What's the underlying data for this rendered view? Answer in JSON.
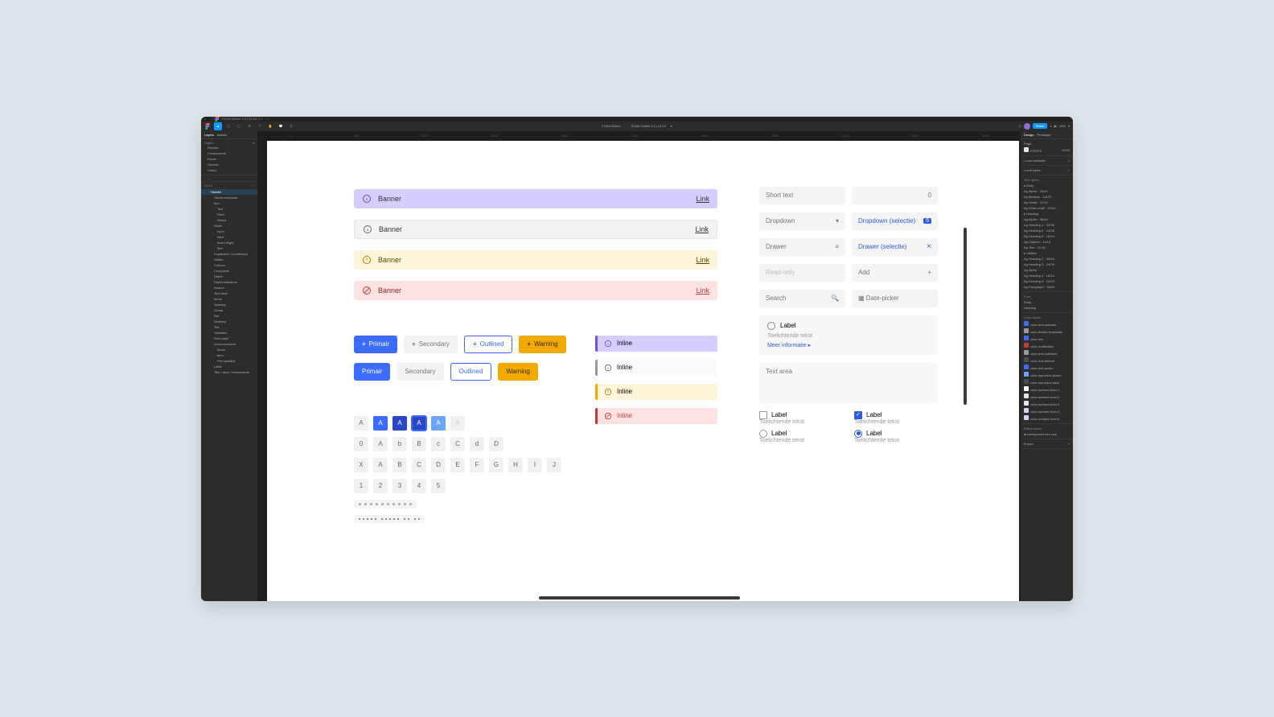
{
  "tabbar": {
    "tab_title": "FUNA Online 2.0 | UI Kit"
  },
  "toolbar": {
    "center_left": "FUNA Online",
    "center_right": "FUNA Online 2.0 | UI Kit",
    "share": "Share",
    "zoom": "16%"
  },
  "left_panel": {
    "tabs": {
      "layers": "Layers",
      "assets": "Assets"
    },
    "pages_title": "Pages",
    "pages": [
      "Results",
      "Components",
      "Errors",
      "Generic",
      "Colors"
    ],
    "frame_title": "UI Kit",
    "tree": [
      "Header",
      "Visual composer",
      "Box",
      "Text",
      "Field",
      "Select",
      "Slider",
      "Input",
      "Alert",
      "Auto height",
      "Box",
      "Expanded / Condensed",
      "States",
      "Colours",
      "Composite",
      "Depth",
      "Depth indicators",
      "Search",
      "Text label",
      "Items",
      "Spacing",
      "Group",
      "Ref",
      "Warning",
      "Tint",
      "Variables",
      "Field label",
      "Announcement",
      "Items",
      "Item",
      "Pre-headline",
      "Label",
      "Title / desc / breadcrumb"
    ]
  },
  "canvas": {
    "banners": [
      {
        "label": "Banner",
        "link": "Link",
        "variant": "purple"
      },
      {
        "label": "Banner",
        "link": "Link",
        "variant": "grey"
      },
      {
        "label": "Banner",
        "link": "Link",
        "variant": "yellow"
      },
      {
        "label": "Banner",
        "link": "Link",
        "variant": "red"
      }
    ],
    "buttons_row1": [
      {
        "label": "Primair",
        "variant": "primary",
        "icon": true
      },
      {
        "label": "Secondary",
        "variant": "secondary",
        "icon": true
      },
      {
        "label": "Outlined",
        "variant": "outlined",
        "icon": true
      },
      {
        "label": "Warning",
        "variant": "warning",
        "icon": true
      }
    ],
    "buttons_row2": [
      {
        "label": "Primair",
        "variant": "primary"
      },
      {
        "label": "Secondary",
        "variant": "secondary"
      },
      {
        "label": "Outlined",
        "variant": "outlined"
      },
      {
        "label": "Warning",
        "variant": "warning"
      }
    ],
    "chips1": [
      "A",
      "A",
      "A",
      "A",
      "A",
      "A"
    ],
    "chips2": [
      "0",
      "A",
      "b",
      "B",
      "c",
      "C",
      "d",
      "D"
    ],
    "chips3": [
      "X",
      "A",
      "B",
      "C",
      "D",
      "E",
      "F",
      "G",
      "H",
      "I",
      "J"
    ],
    "chips4": [
      "1",
      "2",
      "3",
      "4",
      "5"
    ],
    "inline": [
      {
        "label": "Inline",
        "variant": "purple"
      },
      {
        "label": "Inline",
        "variant": "grey"
      },
      {
        "label": "Inline",
        "variant": "yellow"
      },
      {
        "label": "Inline",
        "variant": "red"
      }
    ],
    "inputs": {
      "short_text": "Short text",
      "number": "0",
      "dropdown": "Dropdown",
      "dropdown_sel": "Dropdown (selectie)",
      "dropdown_badge": "5",
      "drawer": "Drawer",
      "drawer_sel": "Drawer (selectie)",
      "read_only": "Read-only",
      "add": "Add",
      "search": "Search",
      "date": "Date-picker",
      "radio_card": {
        "label": "Label",
        "sub": "Toelichtende tekst",
        "more": "Meer informatie"
      },
      "textarea": "Text area",
      "cb1": "Label",
      "cb1sub": "Toelichtende tekst",
      "cb2": "Label",
      "cb2sub": "Toelichtende tekst",
      "rb1": "Label",
      "rb1sub": "Toelichtende tekst",
      "rb2": "Label",
      "rb2sub": "Toelichtende tekst"
    }
  },
  "right_panel": {
    "tabs": {
      "design": "Design",
      "prototype": "Prototype"
    },
    "page": "Page",
    "page_color": "F5F5F5",
    "page_pct": "100%",
    "local_vars": "Local variables",
    "local_vars_count": "1",
    "local_styles": "Local styles",
    "text_styles": "Text styles",
    "text_list": [
      {
        "name": "Body"
      },
      {
        "name": "Alpha · 16/24"
      },
      {
        "name": "Medium · 14/20"
      },
      {
        "name": "Small · 12/16"
      },
      {
        "name": "Extra small · 10/14"
      },
      {
        "name": "Heading"
      },
      {
        "name": "Alpha · 36/44"
      },
      {
        "name": "Heading 1 · 32/36"
      },
      {
        "name": "Heading 2 · 24/28"
      },
      {
        "name": "Heading 3 · 18/24"
      },
      {
        "name": "Caption · 11/16"
      },
      {
        "name": "Text · 11/16"
      },
      {
        "name": "Utilities"
      },
      {
        "name": "Heading 1 · 36/44"
      },
      {
        "name": "Heading 2 · 24/28"
      },
      {
        "name": "Alpha"
      },
      {
        "name": "Heading 4 · 16/24"
      },
      {
        "name": "Heading 5 · 14/20"
      },
      {
        "name": "Paragraph · 16/22"
      }
    ],
    "font": "Font",
    "font_list": [
      "Body",
      "Heading"
    ],
    "color_styles": "Color styles",
    "color_list": [
      "color-blue-primary",
      "color-divider-emphasis",
      "color-link",
      "color-notification",
      "color-text-subdued",
      "color-text-default",
      "color-text-action",
      "color-input-text-action",
      "color-input-text-label",
      "color-surface-level-1",
      "color-surface-level-2",
      "color-surface-level-3",
      "color-surface-level-4",
      "color-surface-level-5"
    ],
    "effects": "Effect styles",
    "effects_list": [
      "background-blur-ups"
    ],
    "export": "Export"
  }
}
